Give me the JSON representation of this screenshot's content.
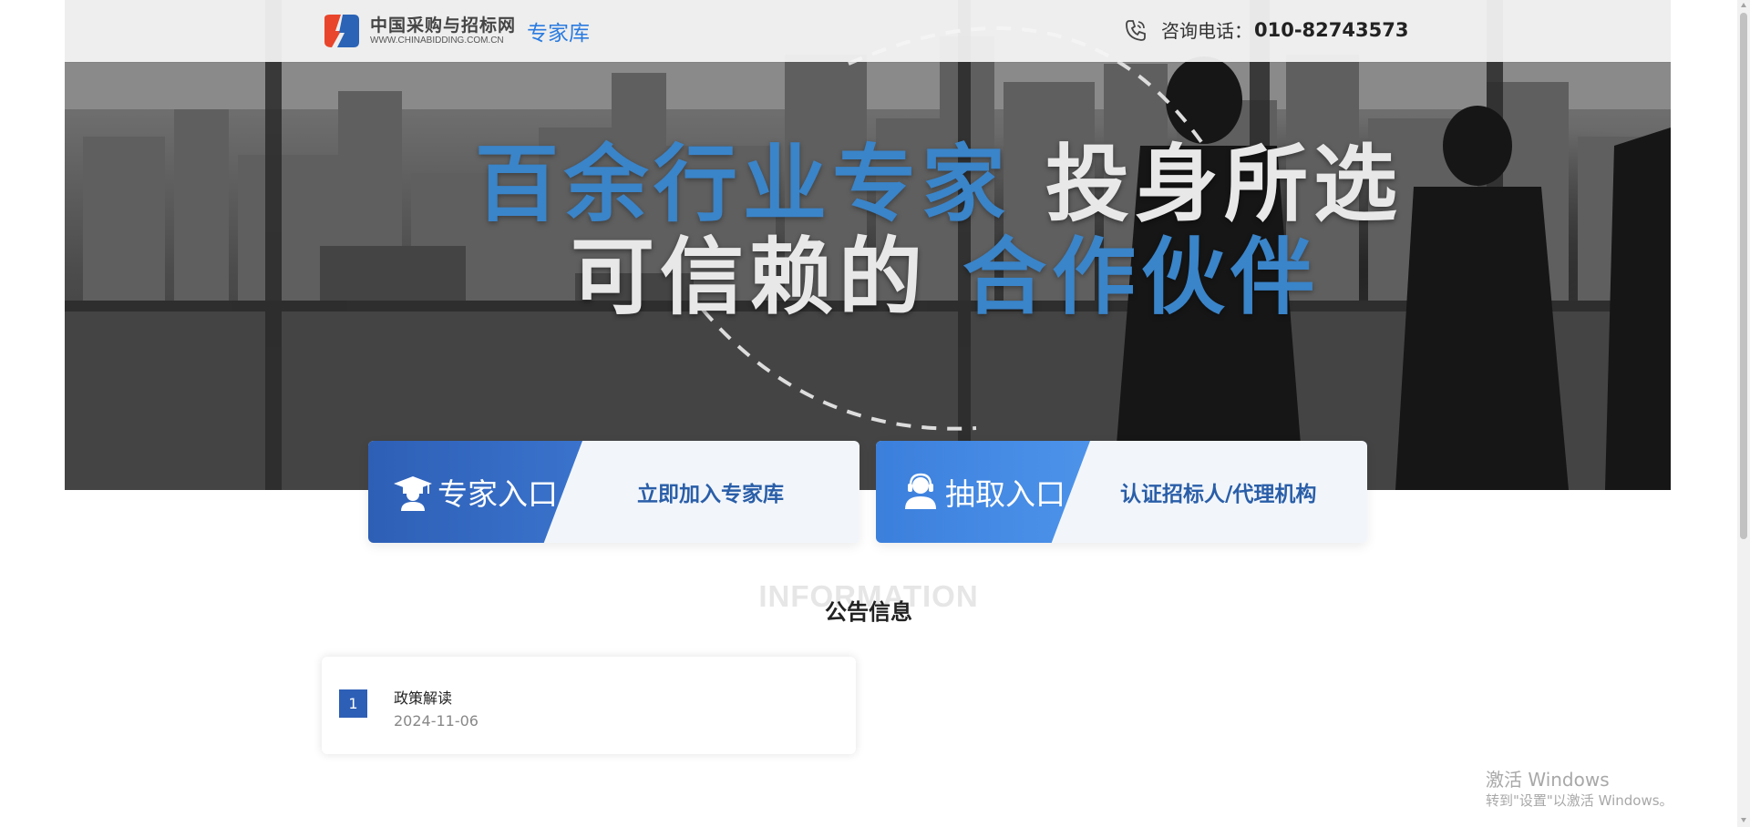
{
  "header": {
    "logo_cn": "中国采购与招标网",
    "logo_en": "WWW.CHINABIDDING.COM.CN",
    "logo_sub": "专家库",
    "phone_label": "咨询电话：",
    "phone_number": "010-82743573"
  },
  "hero": {
    "line1_blue": "百余行业专家",
    "line1_white": "投身所选",
    "line2_white": "可信赖的",
    "line2_blue": "合作伙伴"
  },
  "entries": [
    {
      "label": "专家入口",
      "action": "立即加入专家库",
      "icon": "expert-graduate-icon",
      "color": "#2e5fb6"
    },
    {
      "label": "抽取入口",
      "action": "认证招标人/代理机构",
      "icon": "user-headset-icon",
      "color": "#3b7fdc"
    }
  ],
  "info": {
    "bg_text": "INFORMATION",
    "title": "公告信息",
    "items": [
      {
        "num": "1",
        "title": "政策解读",
        "date": "2024-11-06"
      }
    ]
  },
  "watermark": {
    "title": "激活 Windows",
    "subtitle": "转到\"设置\"以激活 Windows。"
  },
  "colors": {
    "accent_blue": "#3a84c9",
    "brand_blue": "#2a7be0"
  }
}
